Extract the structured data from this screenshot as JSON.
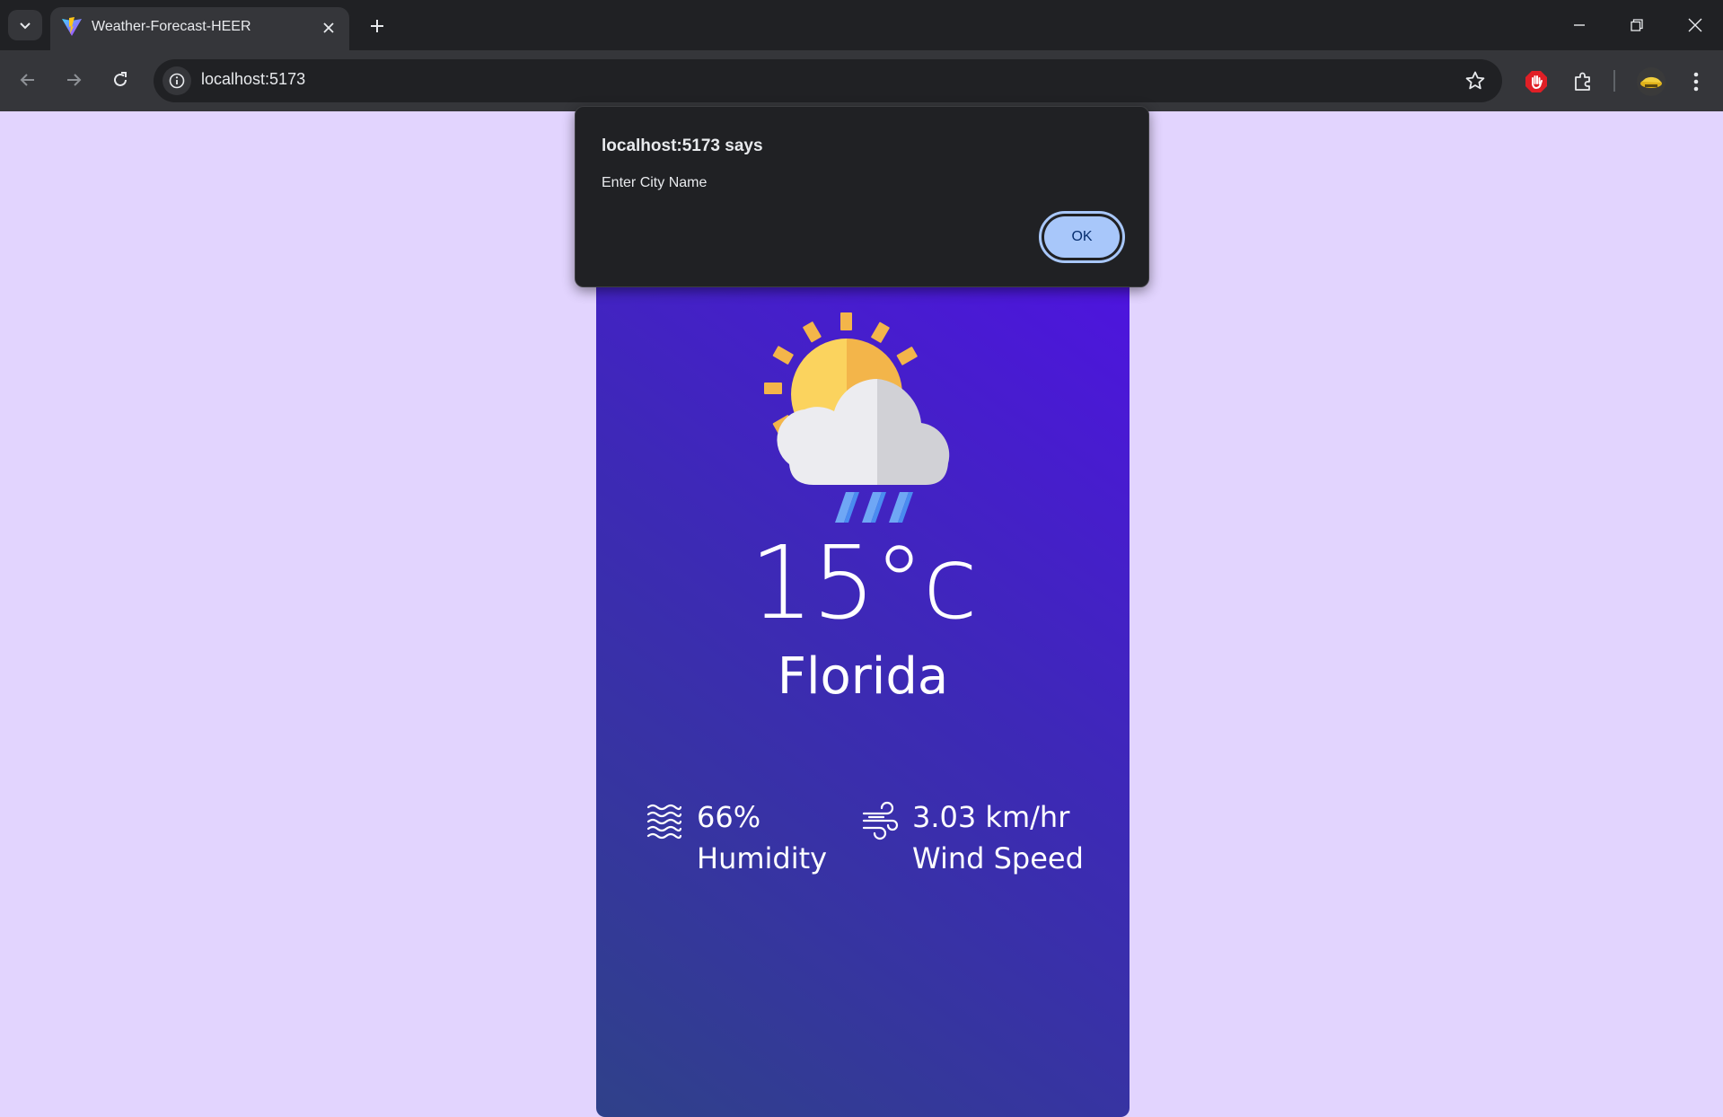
{
  "browser": {
    "tab_title": "Weather-Forecast-HEER",
    "url": "localhost:5173"
  },
  "weather": {
    "temperature": "15°c",
    "city": "Florida",
    "humidity_value": "66%",
    "humidity_label": "Humidity",
    "wind_value": "3.03 km/hr",
    "wind_label": "Wind Speed",
    "condition_icon": "sun-cloud-rain-icon"
  },
  "dialog": {
    "title": "localhost:5173 says",
    "message": "Enter City Name",
    "ok_label": "OK"
  },
  "colors": {
    "page_background": "#e2d4fe",
    "card_gradient_top": "#4e14df",
    "card_gradient_bottom": "#2f4189",
    "dialog_button": "#a8c7fa"
  }
}
